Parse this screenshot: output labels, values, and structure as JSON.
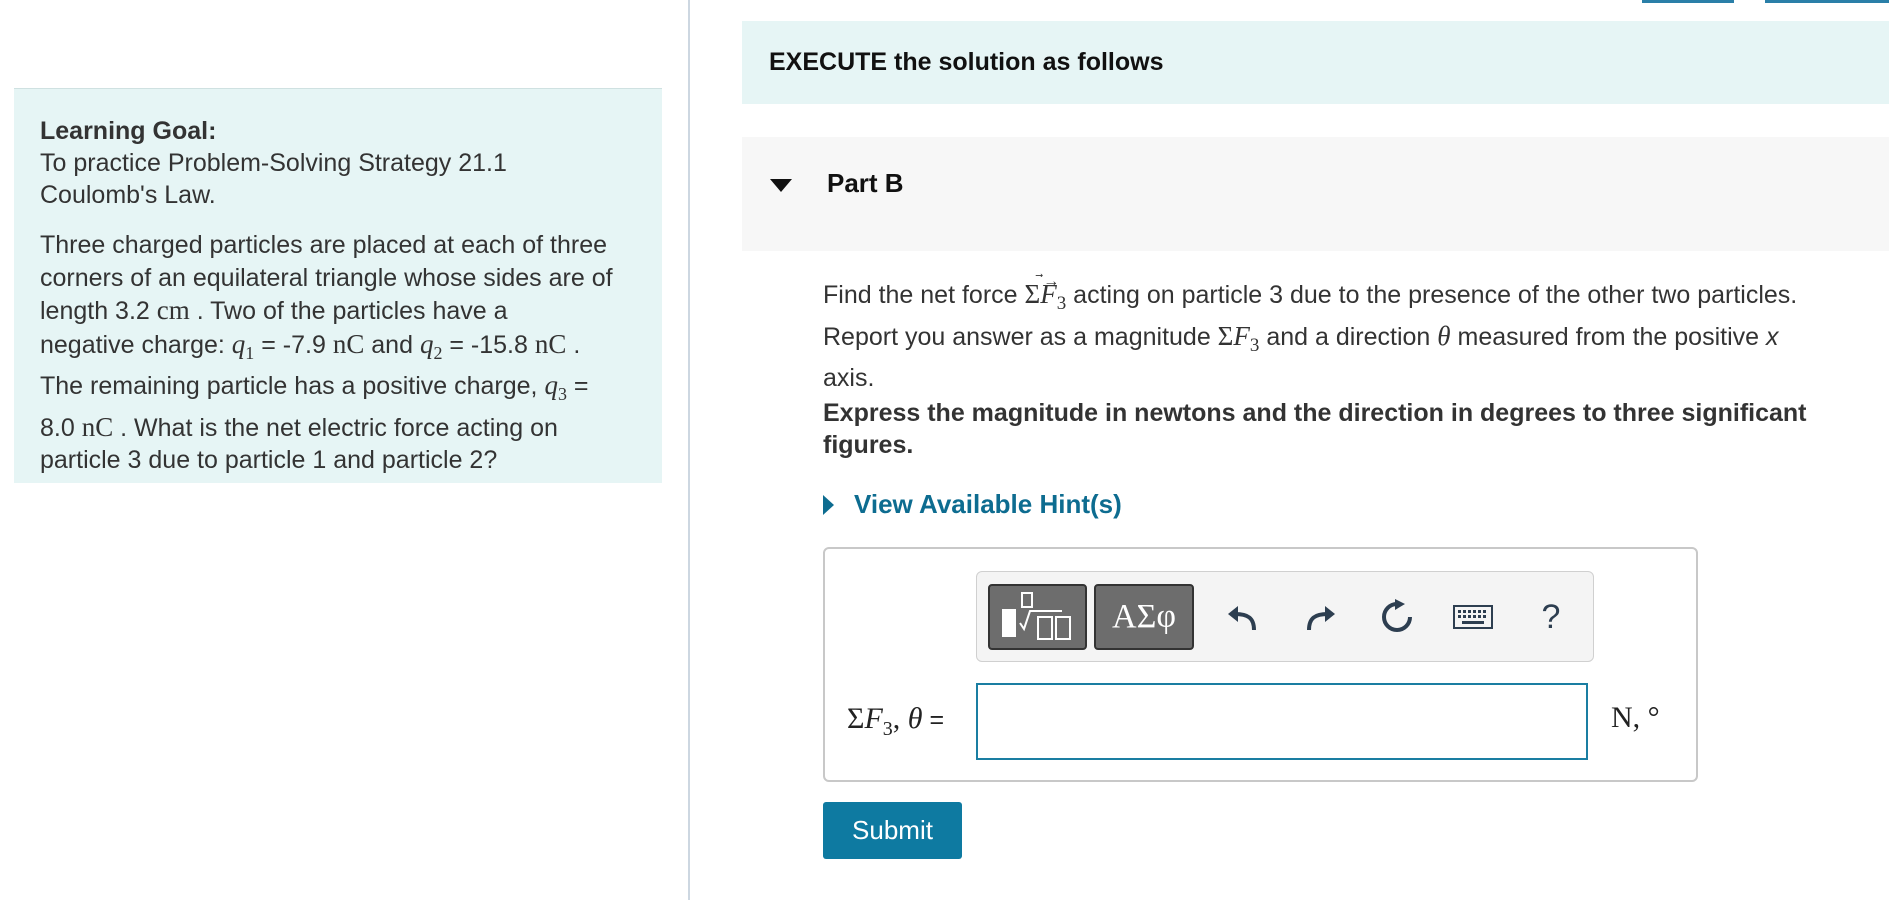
{
  "goal": {
    "heading": "Learning Goal:",
    "text_line1": "To practice Problem-Solving Strategy 21.1",
    "text_line2": "Coulomb's Law.",
    "p1": "Three charged particles are placed at each of three",
    "p2": "corners of an equilateral triangle whose sides are of",
    "p3_a": "length 3.2 ",
    "p3_unit": "cm",
    "p3_b": " . Two of the particles have a",
    "p4_a": "negative charge: ",
    "q1": "q",
    "q1_sub": "1",
    "q1_val": " = -7.9 ",
    "q1_unit": "nC",
    "and": " and ",
    "q2": "q",
    "q2_sub": "2",
    "q2_val": " = -15.8 ",
    "q2_unit": "nC",
    "q2_end": " .",
    "p5_a": "The remaining particle has a positive charge, ",
    "q3": "q",
    "q3_sub": "3",
    "q3_eq": " =",
    "p6_val": "8.0 ",
    "p6_unit": "nC",
    "p6_b": " . What is the net electric force acting on",
    "p7": "particle 3 due to particle 1 and particle 2?"
  },
  "execute_banner": "EXECUTE the solution as follows",
  "part": {
    "title": "Part B"
  },
  "question": {
    "l1_a": "Find the net force ",
    "sigma": "Σ",
    "F": "F",
    "sub3": "3",
    "l1_b": " acting on particle 3 due to the presence of the other two particles.",
    "l2_a": "Report you answer as a magnitude ",
    "l2_b": " and a direction ",
    "theta": "θ",
    "l2_c": " measured from the positive ",
    "x": "x",
    "l3": "axis."
  },
  "instruction": "Express the magnitude in newtons and the direction in degrees to three significant figures.",
  "hint_label": "View Available Hint(s)",
  "toolbar": {
    "symbols_label": "ΑΣφ",
    "undo_glyph": "↶",
    "redo_glyph": "↷",
    "reset_glyph": "↻",
    "help_label": "?"
  },
  "answer": {
    "label_sigma": "Σ",
    "label_F": "F",
    "label_sub": "3",
    "label_sep": ", ",
    "label_theta": "θ",
    "label_eq": " =",
    "value": "",
    "units": "N, °"
  },
  "submit_label": "Submit",
  "colors": {
    "accent": "#0e7aa1",
    "panel_bg": "#e6f5f5",
    "link": "#0d6c90"
  }
}
